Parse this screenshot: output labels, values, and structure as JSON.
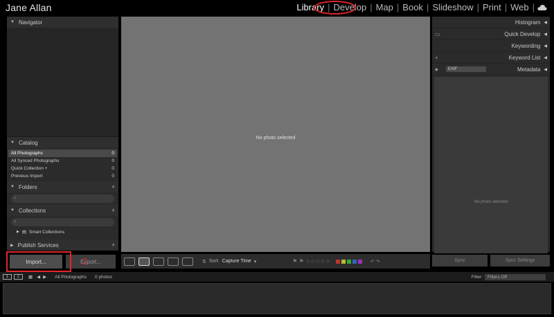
{
  "identity": "Jane Allan",
  "modules": [
    "Library",
    "Develop",
    "Map",
    "Book",
    "Slideshow",
    "Print",
    "Web"
  ],
  "active_module": "Library",
  "annotations": {
    "one": "1",
    "two": "2",
    "color": "#e3262b"
  },
  "left_panel": {
    "navigator": "Navigator",
    "catalog": {
      "title": "Catalog",
      "items": [
        {
          "label": "All Photographs",
          "count": "0"
        },
        {
          "label": "All Synced Photographs",
          "count": "0"
        },
        {
          "label": "Quick Collection +",
          "count": "0"
        },
        {
          "label": "Previous Import",
          "count": "0"
        }
      ]
    },
    "folders": "Folders",
    "collections": "Collections",
    "smart_collections": "Smart Collections",
    "publish_services": "Publish Services"
  },
  "center": {
    "empty_message": "No photo selected"
  },
  "right_panel": {
    "histogram": "Histogram",
    "quick_develop": "Quick Develop",
    "keywording": "Keywording",
    "keyword_list": "Keyword List",
    "metadata": "Metadata",
    "metadata_preset": "EXIF",
    "metadata_empty": "No photo selected"
  },
  "buttons": {
    "import": "Import...",
    "export": "Export...",
    "sync": "Sync",
    "sync_settings": "Sync Settings"
  },
  "toolbar": {
    "sort_label": "Sort:",
    "sort_value": "Capture Time"
  },
  "filmstrip": {
    "source": "All Photographs",
    "photo_count": "0 photos",
    "filter_label": "Filter:",
    "filter_value": "Filters Off"
  },
  "colors": {
    "background": "#000000",
    "panel": "#2b2b2b",
    "center": "#737373"
  }
}
